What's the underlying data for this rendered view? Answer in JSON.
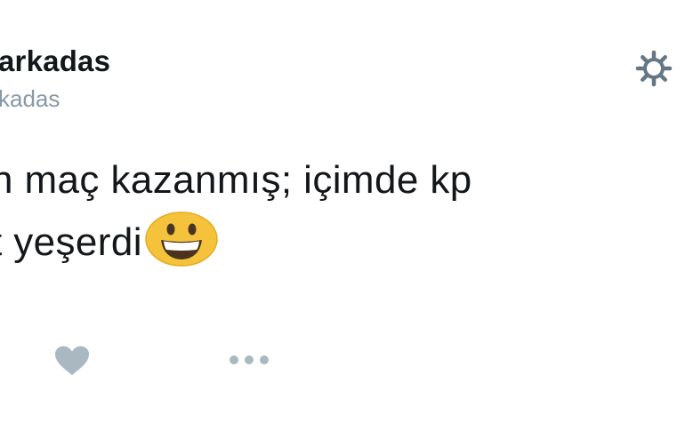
{
  "tweet": {
    "display_name": "arkadas",
    "handle": "kadas",
    "text_line_1": "n maç kazanmış; içimde kp",
    "text_line_2": "t yeşerdi",
    "emoji": "grinning-face-emoji"
  },
  "actions": {
    "settings_icon": "gear-icon",
    "like_icon": "heart-icon",
    "more_icon": "more-dots-icon"
  },
  "colors": {
    "text": "#14171a",
    "secondary": "#8899a6",
    "icon": "#8899a6",
    "icon_dark": "#657786",
    "emoji_yellow": "#f5c33b"
  }
}
